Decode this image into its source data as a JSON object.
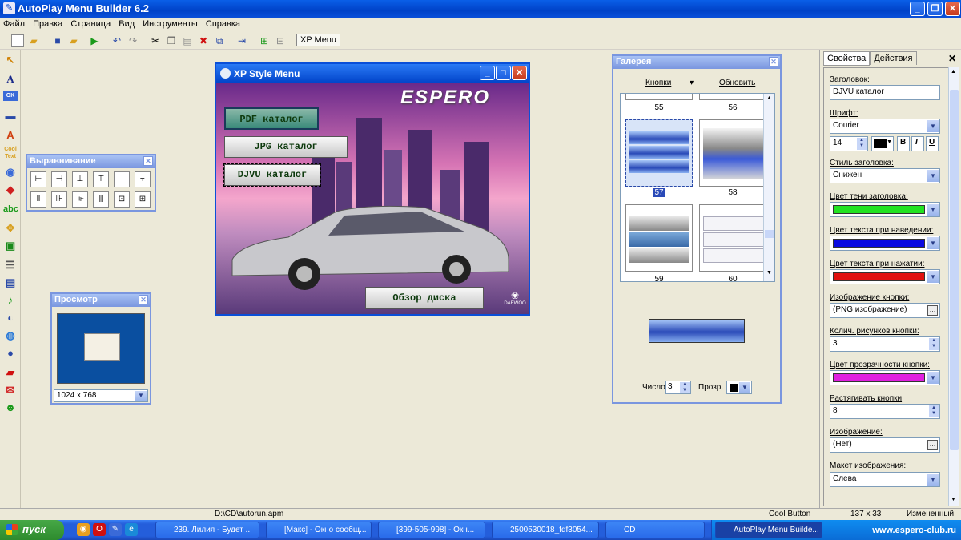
{
  "app": {
    "title": "AutoPlay Menu Builder 6.2"
  },
  "menu": [
    "Файл",
    "Правка",
    "Страница",
    "Вид",
    "Инструменты",
    "Справка"
  ],
  "toolbar": {
    "page_tab": "XP Menu"
  },
  "align_panel": {
    "title": "Выравнивание"
  },
  "preview_panel": {
    "title": "Просмотр",
    "resolution": "1024 x 768"
  },
  "xp_window": {
    "title": "XP Style Menu",
    "logo": "ESPERO",
    "brand": "DAEWOO",
    "buttons": [
      "PDF каталог",
      "JPG каталог",
      "DJVU каталог"
    ],
    "bottom_button": "Обзор диска"
  },
  "gallery": {
    "title": "Галерея",
    "menu_buttons": "Кнопки",
    "menu_refresh": "Обновить",
    "numbers": [
      "55",
      "56",
      "57",
      "58",
      "59",
      "60"
    ],
    "count_label": "Число",
    "count_value": "3",
    "opacity_label": "Прозр."
  },
  "props": {
    "tab_props": "Свойства",
    "tab_actions": "Действия",
    "caption_label": "Заголовок:",
    "caption_value": "DJVU каталог",
    "font_label": "Шрифт:",
    "font_value": "Courier",
    "font_size": "14",
    "bold": "B",
    "italic": "I",
    "underline": "U",
    "caption_style_label": "Стиль заголовка:",
    "caption_style_value": "Снижен",
    "shadow_color_label": "Цвет тени заголовка:",
    "hover_color_label": "Цвет текста при наведении:",
    "press_color_label": "Цвет текста при нажатии:",
    "button_image_label": "Изображение кнопки:",
    "button_image_value": "(PNG изображение)",
    "image_count_label": "Колич. рисунков кнопки:",
    "image_count_value": "3",
    "transparency_label": "Цвет прозрачности кнопки:",
    "stretch_label": "Растягивать кнопки",
    "stretch_value": "8",
    "image_label": "Изображение:",
    "image_value": "(Нет)",
    "layout_label": "Макет изображения:",
    "layout_value": "Слева",
    "colors": {
      "shadow": "#22e322",
      "hover": "#0a0ae0",
      "press": "#e01010",
      "transparency": "#e020e0"
    }
  },
  "status": {
    "path": "D:\\CD\\autorun.apm",
    "type": "Cool Button",
    "size": "137 x 33",
    "state": "Измененный"
  },
  "taskbar": {
    "start": "пуск",
    "tasks": [
      "239. Лилия - Будет ...",
      "[Макс] - Окно сообщ...",
      "[399-505-998] - Окн...",
      "2500530018_fdf3054...",
      "CD",
      "AutoPlay Menu Builde..."
    ],
    "watermark": "www.espero-club.ru"
  }
}
